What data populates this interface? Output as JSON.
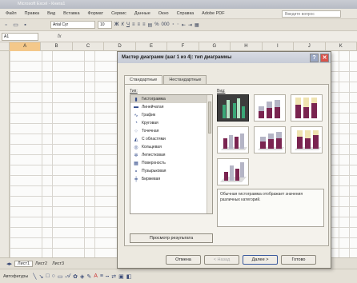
{
  "excel": {
    "title": "Microsoft Excel - Книга1",
    "menu": [
      "Файл",
      "Правка",
      "Вид",
      "Вставка",
      "Формат",
      "Сервис",
      "Данные",
      "Окно",
      "Справка",
      "Adobe PDF"
    ],
    "help_placeholder": "Введите вопрос",
    "font_name": "Arial Cyr",
    "font_size": "10",
    "name_box": "A1",
    "fx_label": "fx",
    "columns": [
      "A",
      "B",
      "C",
      "D",
      "E",
      "F",
      "G",
      "H",
      "I",
      "J",
      "K"
    ],
    "sheets": [
      "Лист1",
      "Лист2",
      "Лист3"
    ],
    "draw_label": "Автофигуры"
  },
  "dialog": {
    "title": "Мастер диаграмм (шаг 1 из 4): тип диаграммы",
    "tabs": [
      "Стандартные",
      "Нестандартные"
    ],
    "type_label": "Тип:",
    "view_label": "Вид:",
    "chart_types": [
      {
        "label": "Гистограмма",
        "icon": "column-chart-icon"
      },
      {
        "label": "Линейчатая",
        "icon": "bar-chart-icon"
      },
      {
        "label": "График",
        "icon": "line-chart-icon"
      },
      {
        "label": "Круговая",
        "icon": "pie-chart-icon"
      },
      {
        "label": "Точечная",
        "icon": "scatter-chart-icon"
      },
      {
        "label": "С областями",
        "icon": "area-chart-icon"
      },
      {
        "label": "Кольцевая",
        "icon": "doughnut-chart-icon"
      },
      {
        "label": "Лепестковая",
        "icon": "radar-chart-icon"
      },
      {
        "label": "Поверхность",
        "icon": "surface-chart-icon"
      },
      {
        "label": "Пузырьковая",
        "icon": "bubble-chart-icon"
      },
      {
        "label": "Биржевая",
        "icon": "stock-chart-icon"
      }
    ],
    "selected_type": "Гистограмма",
    "description": "Обычная гистограмма отображает значения различных категорий.",
    "preview_button": "Просмотр результата",
    "buttons": {
      "cancel": "Отмена",
      "back": "< Назад",
      "next": "Далее >",
      "finish": "Готово"
    },
    "colors": {
      "bar_green": "#2e8b57",
      "bar_maroon": "#7a2450",
      "bar_gray": "#b5b5c6",
      "bar_cream": "#efe3b0"
    }
  }
}
